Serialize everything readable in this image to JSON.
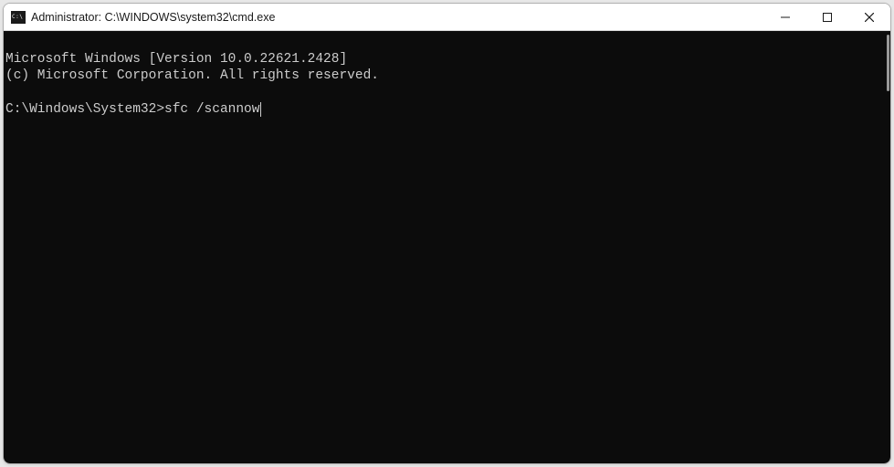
{
  "window": {
    "title": "Administrator: C:\\WINDOWS\\system32\\cmd.exe"
  },
  "terminal": {
    "line1": "Microsoft Windows [Version 10.0.22621.2428]",
    "line2": "(c) Microsoft Corporation. All rights reserved.",
    "blank": "",
    "prompt": "C:\\Windows\\System32>",
    "command": "sfc /scannow"
  }
}
